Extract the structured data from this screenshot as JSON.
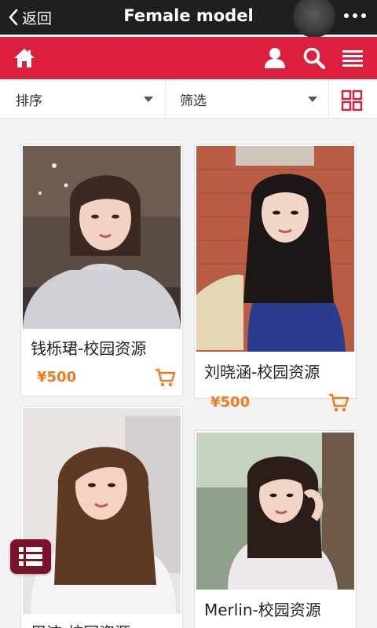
{
  "titlebar": {
    "back_label": "返回",
    "title": "Female model"
  },
  "filters": {
    "sort_label": "排序",
    "filter_label": "筛选"
  },
  "colors": {
    "brand_red": "#dc1f3c",
    "price_orange": "#f07a1e",
    "titlebar_bg": "#1f1f1f",
    "float_menu": "#7a1329"
  },
  "products": [
    {
      "name": "钱栎珺-校园资源",
      "price": "¥500"
    },
    {
      "name": "刘晓涵-校园资源",
      "price": "¥500"
    },
    {
      "name": "周洁-校园资源"
    },
    {
      "name": "Merlin-校园资源"
    }
  ],
  "icons": [
    "back-chevron-icon",
    "more-icon",
    "home-icon",
    "user-icon",
    "search-icon",
    "menu-icon",
    "grid-icon",
    "cart-icon",
    "list-menu-icon"
  ]
}
